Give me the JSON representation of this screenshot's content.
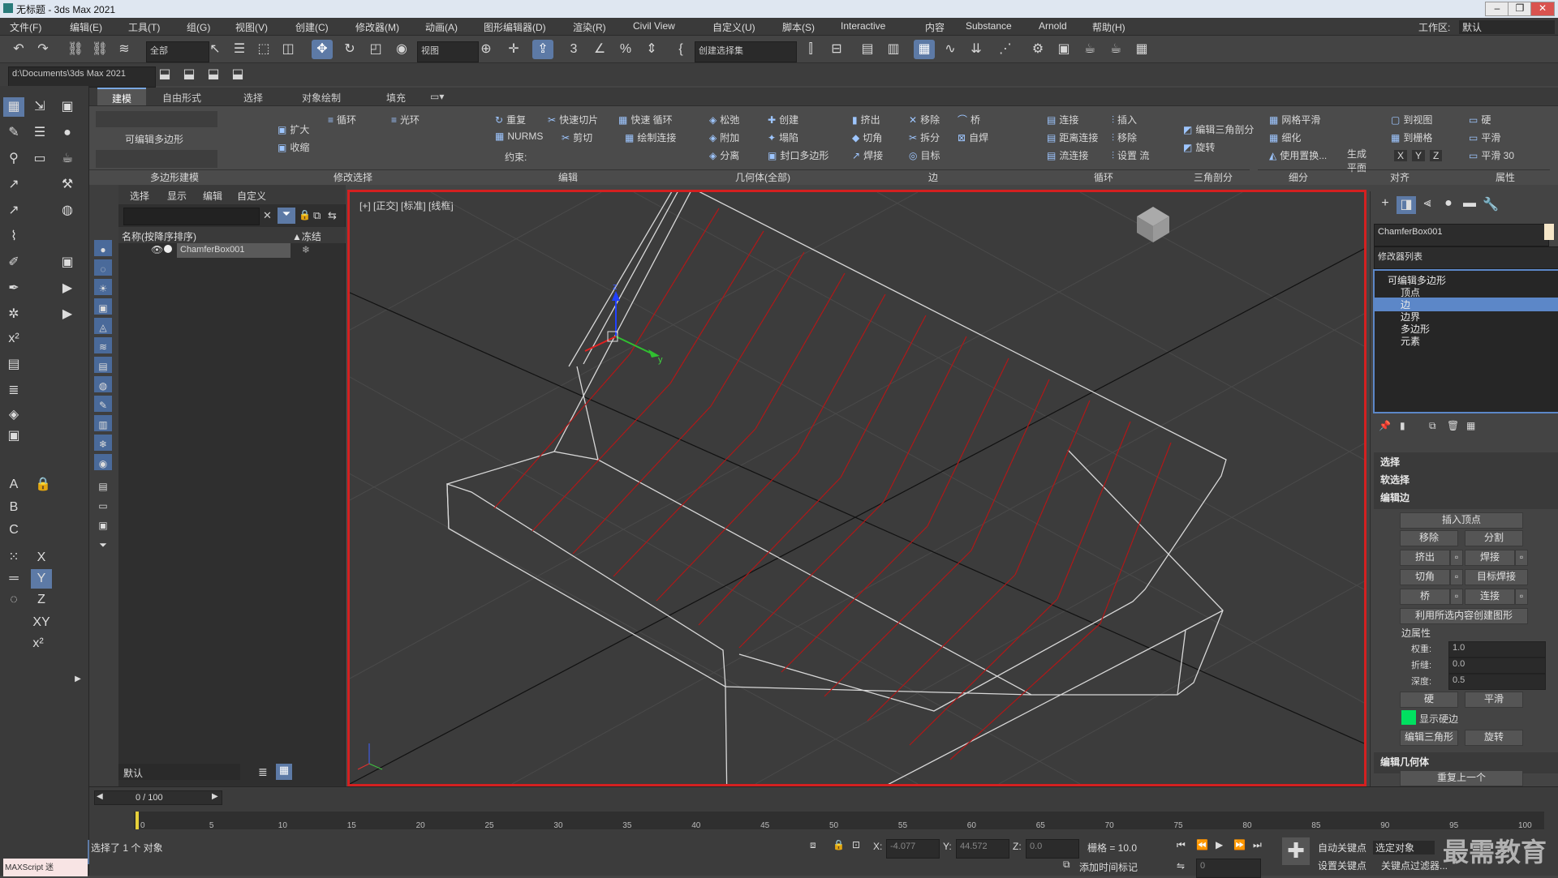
{
  "window": {
    "title": "无标题 - 3ds Max 2021",
    "workspace_label": "工作区:",
    "workspace_value": "默认"
  },
  "menu": [
    "文件(F)",
    "编辑(E)",
    "工具(T)",
    "组(G)",
    "视图(V)",
    "创建(C)",
    "修改器(M)",
    "动画(A)",
    "图形编辑器(D)",
    "渲染(R)",
    "Civil View",
    "自定义(U)",
    "脚本(S)",
    "Interactive",
    "内容",
    "Substance",
    "Arnold",
    "帮助(H)"
  ],
  "toolbar": {
    "selection_filter": "全部",
    "ref_coord": "视图",
    "named_selection": "创建选择集"
  },
  "path": {
    "project_path": "d:\\Documents\\3ds Max 2021"
  },
  "ribbon": {
    "tabs": [
      "建模",
      "自由形式",
      "选择",
      "对象绘制",
      "填充"
    ],
    "poly_label": "可编辑多边形",
    "groups": [
      "多边形建模",
      "修改选择",
      "编辑",
      "几何体(全部)",
      "边",
      "循环",
      "三角剖分",
      "细分",
      "对齐",
      "属性"
    ],
    "buttons": {
      "grow": "扩大",
      "shrink": "收缩",
      "loop": "循环",
      "ring": "光环",
      "repeat": "重复",
      "quickslice": "快速切片",
      "quickloop": "快速 循环",
      "nurms": "NURMS",
      "cut": "剪切",
      "connect_draw": "绘制连接",
      "constraint": "约束:",
      "relax": "松弛",
      "create": "创建",
      "attach": "附加",
      "collapse": "塌陷",
      "detach": "分离",
      "cap": "封口多边形",
      "extrude": "挤出",
      "remove": "移除",
      "bridge": "桥",
      "chamfer": "切角",
      "split": "拆分",
      "autoweld": "自焊",
      "weld": "焊接",
      "target": "目标",
      "connect": "连接",
      "insert": "插入",
      "distconnect": "距离连接",
      "loop_remove": "移除",
      "flowconnect": "流连接",
      "setflow": "设置 流",
      "edit_tri": "编辑三角剖分",
      "turn": "旋转",
      "meshsmooth": "网格平滑",
      "tessellate": "细化",
      "usedisp": "使用置换...",
      "generate": "生成",
      "plane": "平面",
      "to_view": "到视图",
      "to_grid": "到栅格",
      "x": "X",
      "y": "Y",
      "z": "Z",
      "hard": "硬",
      "smooth": "平滑",
      "smooth30": "平滑 30"
    }
  },
  "scene": {
    "tabs": [
      "选择",
      "显示",
      "编辑",
      "自定义"
    ],
    "col_name": "名称(按降序排序)",
    "col_freeze": "▲冻结",
    "object": "ChamferBox001",
    "layer": "默认"
  },
  "viewport": {
    "label": "[+] [正交] [标准] [线框]"
  },
  "command_panel": {
    "object_name": "ChamferBox001",
    "modifier_list": "修改器列表",
    "stack": [
      "可编辑多边形",
      "顶点",
      "边",
      "边界",
      "多边形",
      "元素"
    ],
    "rollouts": {
      "select": "选择",
      "soft_select": "软选择",
      "edit_edges": "编辑边",
      "edit_geometry": "编辑几何体"
    },
    "buttons": {
      "insert_vertex": "插入顶点",
      "remove": "移除",
      "split": "分割",
      "extrude": "挤出",
      "weld": "焊接",
      "chamfer": "切角",
      "target_weld": "目标焊接",
      "bridge": "桥",
      "connect": "连接",
      "create_shape": "利用所选内容创建图形",
      "edge_props": "边属性",
      "hard": "硬",
      "smooth": "平滑",
      "show_hard": "显示硬边",
      "edit_tri": "编辑三角形",
      "turn": "旋转",
      "repeat_last": "重复上一个"
    },
    "weight_label": "权重:",
    "weight": "1.0",
    "crease_label": "折缝:",
    "crease": "0.0",
    "depth_label": "深度:",
    "depth": "0.5",
    "hard_edge_color": "#00e060"
  },
  "timeline": {
    "frame": "0 / 100",
    "ticks": [
      "0",
      "5",
      "10",
      "15",
      "20",
      "25",
      "30",
      "35",
      "40",
      "45",
      "50",
      "55",
      "60",
      "65",
      "70",
      "75",
      "80",
      "85",
      "90",
      "95",
      "100"
    ]
  },
  "status": {
    "selected": "选择了 1 个 对象",
    "maxscript": "MAXScript 迷",
    "x_label": "X:",
    "x": "-4.077",
    "y_label": "Y:",
    "y": "44.572",
    "z_label": "Z:",
    "z": "0.0",
    "grid": "栅格 = 10.0",
    "add_time_tag": "添加时间标记",
    "auto_key": "自动关键点",
    "set_key": "设置关键点",
    "selected_obj": "选定对象",
    "key_filters": "关键点过滤器...",
    "frame_field": "0"
  },
  "watermark": "最需教育"
}
